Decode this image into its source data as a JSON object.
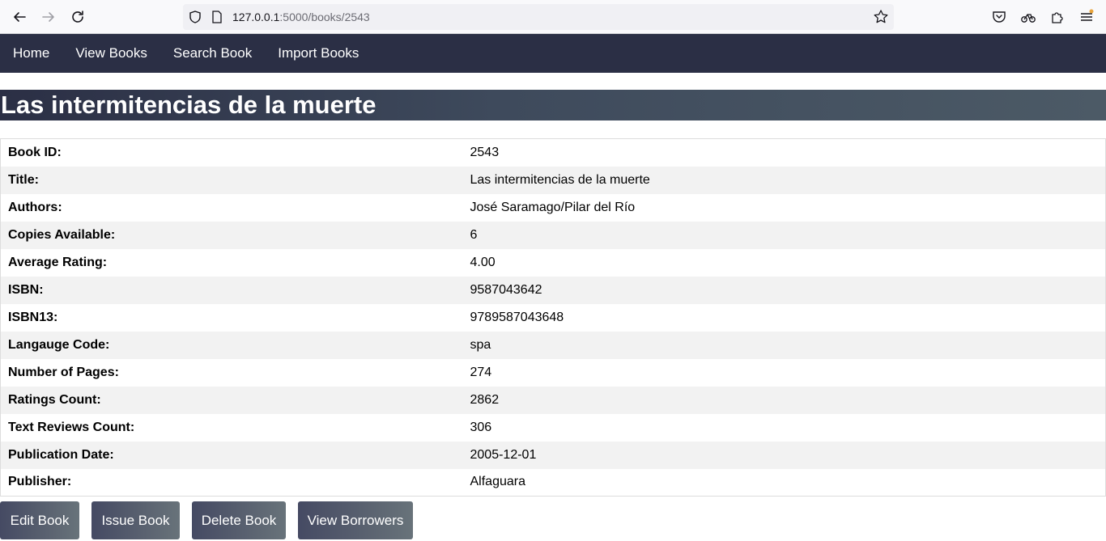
{
  "browser": {
    "url_host": "127.0.0.1",
    "url_rest": ":5000/books/2543",
    "icons": [
      "back-icon",
      "forward-icon",
      "reload-icon",
      "shield-icon",
      "page-icon",
      "bookmark-star-icon",
      "pocket-icon",
      "sync-icon",
      "extensions-icon",
      "menu-icon"
    ]
  },
  "nav": {
    "items": [
      {
        "label": "Home"
      },
      {
        "label": "View Books"
      },
      {
        "label": "Search Book"
      },
      {
        "label": "Import Books"
      }
    ]
  },
  "book": {
    "heading": "Las intermitencias de la muerte",
    "fields": [
      {
        "label": "Book ID:",
        "value": "2543"
      },
      {
        "label": "Title:",
        "value": "Las intermitencias de la muerte"
      },
      {
        "label": "Authors:",
        "value": "José Saramago/Pilar del Río"
      },
      {
        "label": "Copies Available:",
        "value": "6"
      },
      {
        "label": "Average Rating:",
        "value": "4.00"
      },
      {
        "label": "ISBN:",
        "value": "9587043642"
      },
      {
        "label": "ISBN13:",
        "value": "9789587043648"
      },
      {
        "label": "Langauge Code:",
        "value": "spa"
      },
      {
        "label": "Number of Pages:",
        "value": "274"
      },
      {
        "label": "Ratings Count:",
        "value": "2862"
      },
      {
        "label": "Text Reviews Count:",
        "value": "306"
      },
      {
        "label": "Publication Date:",
        "value": "2005-12-01"
      },
      {
        "label": "Publisher:",
        "value": "Alfaguara"
      }
    ]
  },
  "actions": {
    "edit_label": "Edit Book",
    "issue_label": "Issue Book",
    "delete_label": "Delete Book",
    "borrowers_label": "View Borrowers"
  },
  "colors": {
    "nav_bg": "#2b2f45",
    "row_alt": "#f2f2f2",
    "button_gradient_start": "#454a63",
    "button_gradient_end": "#68737a"
  }
}
